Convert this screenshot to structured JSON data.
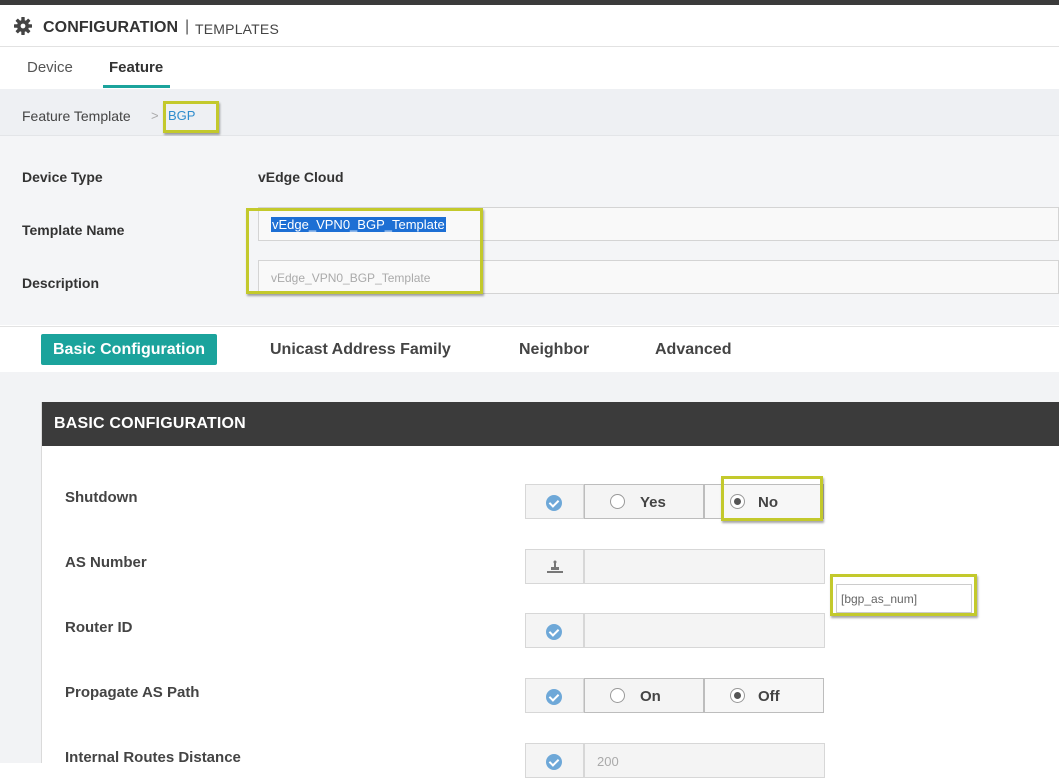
{
  "header": {
    "title": "CONFIGURATION",
    "separator": "|",
    "subtitle": "TEMPLATES"
  },
  "tabs": [
    {
      "label": "Device"
    },
    {
      "label": "Feature",
      "active": true
    }
  ],
  "breadcrumb": {
    "parent": "Feature Template",
    "separator": ">",
    "current": "BGP"
  },
  "template_meta": {
    "device_type_label": "Device Type",
    "device_type_value": "vEdge Cloud",
    "template_name_label": "Template Name",
    "template_name_value": "vEdge_VPN0_BGP_Template",
    "description_label": "Description",
    "description_placeholder": "vEdge_VPN0_BGP_Template"
  },
  "section_tabs": [
    {
      "label": "Basic Configuration",
      "active": true
    },
    {
      "label": "Unicast Address Family"
    },
    {
      "label": "Neighbor"
    },
    {
      "label": "Advanced"
    }
  ],
  "panel": {
    "title": "BASIC CONFIGURATION",
    "fields": {
      "shutdown": {
        "label": "Shutdown",
        "options": [
          "Yes",
          "No"
        ],
        "selected": "No"
      },
      "as_number": {
        "label": "AS Number",
        "variable": "[bgp_as_num]"
      },
      "router_id": {
        "label": "Router ID",
        "value": ""
      },
      "propagate_as_path": {
        "label": "Propagate AS Path",
        "options": [
          "On",
          "Off"
        ],
        "selected": "Off"
      },
      "internal_routes_distance": {
        "label": "Internal Routes Distance",
        "value": "200"
      }
    }
  },
  "colors": {
    "accent": "#1ba39c",
    "highlight": "#c3c92c",
    "link": "#2f8dcd",
    "panel_header": "#3b3b3b",
    "check": "#6ea8d8"
  }
}
